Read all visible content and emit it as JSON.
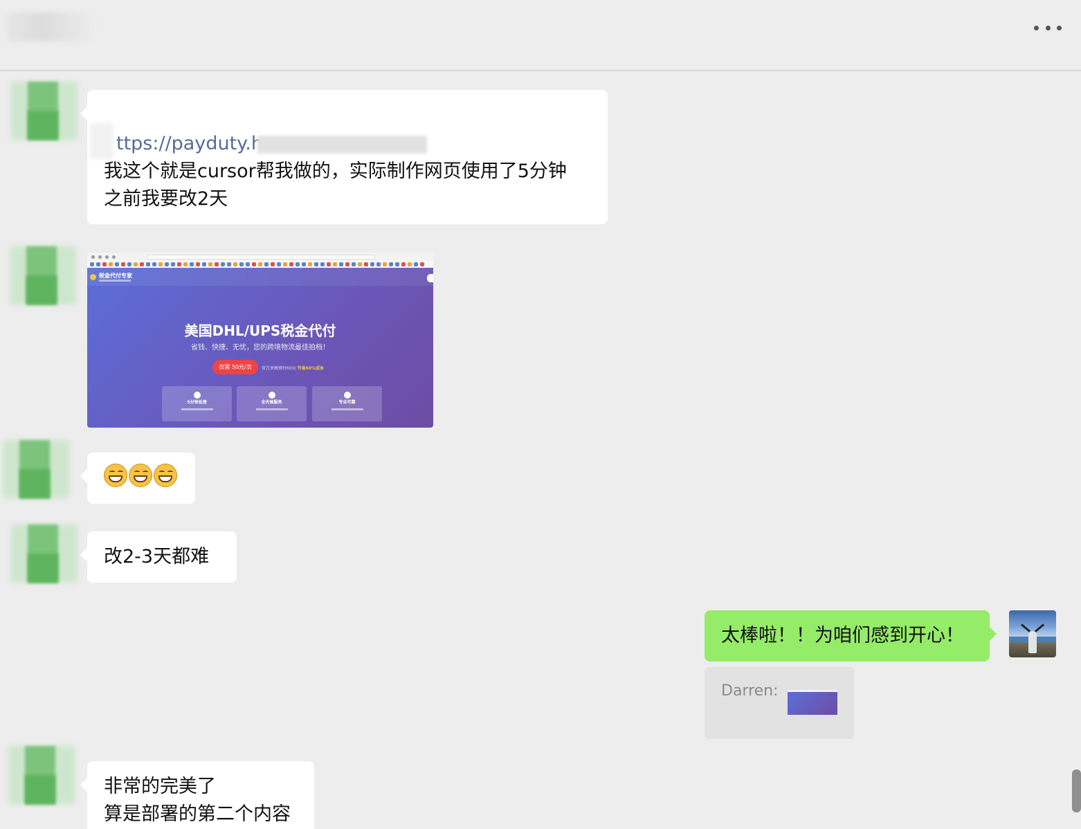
{
  "header": {
    "more_label": "•••"
  },
  "messages": {
    "m1": {
      "link_text": "ttps://payduty.h",
      "line1": "我这个就是cursor帮我做的，实际制作网页使用了5分钟",
      "line2": "之前我要改2天"
    },
    "m2": {
      "screenshot": {
        "hero_title": "美国DHL/UPS税金代付",
        "hero_subtitle": "省钱、快捷、无忧，您的跨境物流最佳拍档！",
        "brand": "税金代付专家",
        "price_pill": "仅需 50元/次",
        "note_prefix": "官方关税预付60元",
        "note_highlight": "节省60%成本",
        "cards": [
          "5分钟处理",
          "全天候服务",
          "专业可靠"
        ],
        "accent_color": "#6b56b8"
      }
    },
    "m3": {
      "emojis": [
        "grinning-face",
        "grinning-face",
        "grinning-face"
      ]
    },
    "m4": {
      "text": "改2-3天都难"
    },
    "m5": {
      "text": "太棒啦！！为咱们感到开心！",
      "quote_name": "Darren:"
    },
    "m6": {
      "line1": "非常的完美了",
      "line2": "算是部署的第二个内容"
    }
  },
  "colors": {
    "background": "#ededed",
    "incoming_bubble": "#ffffff",
    "outgoing_bubble": "#95ec69",
    "link": "#576b95"
  }
}
